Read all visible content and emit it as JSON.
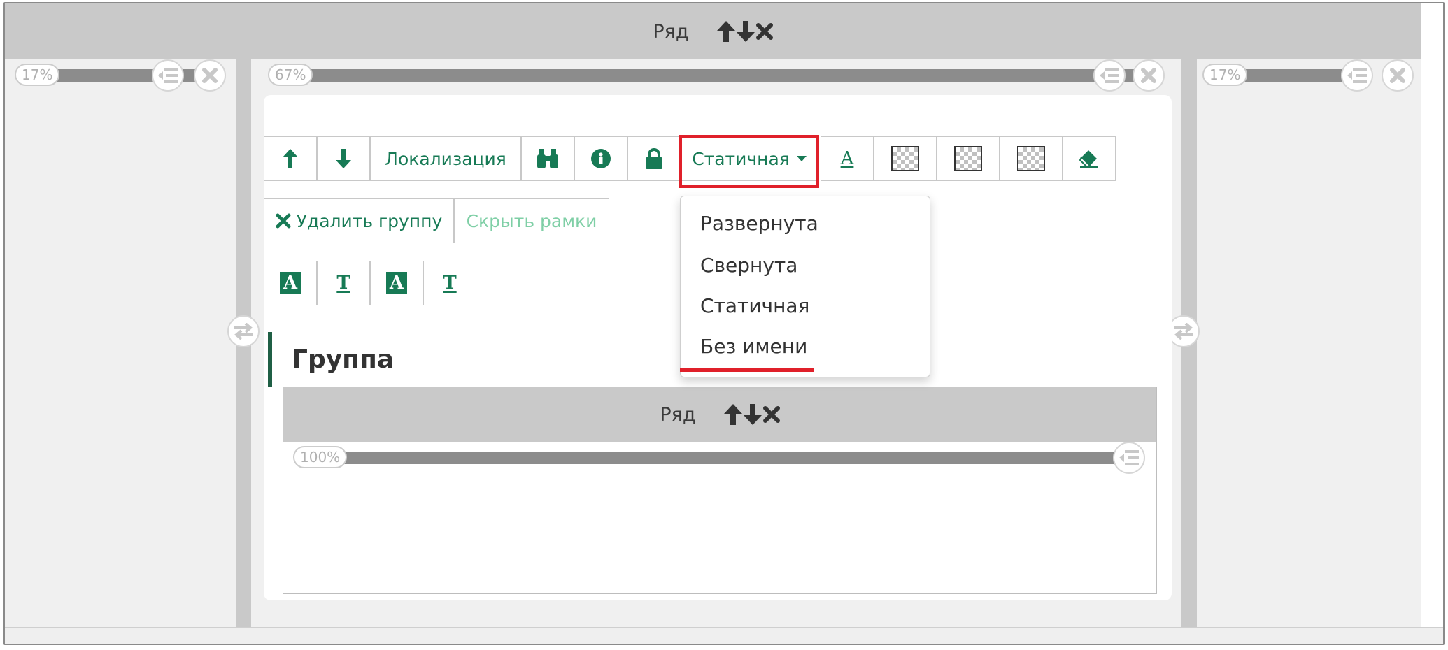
{
  "outer_row": {
    "label": "Ряд"
  },
  "columns": [
    {
      "percent": "17%"
    },
    {
      "percent": "67%"
    },
    {
      "percent": "17%"
    }
  ],
  "toolbar": {
    "localization_label": "Локализация",
    "state_select_label": "Статичная",
    "delete_group_label": "Удалить группу",
    "hide_frames_label": "Скрыть рамки",
    "text_format_a_glyph": "A",
    "text_format_t_glyph": "T"
  },
  "state_dropdown": {
    "options": [
      "Развернута",
      "Свернута",
      "Статичная",
      "Без имени"
    ]
  },
  "group": {
    "title": "Группа"
  },
  "inner_row": {
    "label": "Ряд",
    "column_percent": "100%"
  },
  "colors": {
    "accent": "#177a55",
    "highlight": "#e0202a",
    "row_header": "#c9c9c9"
  }
}
